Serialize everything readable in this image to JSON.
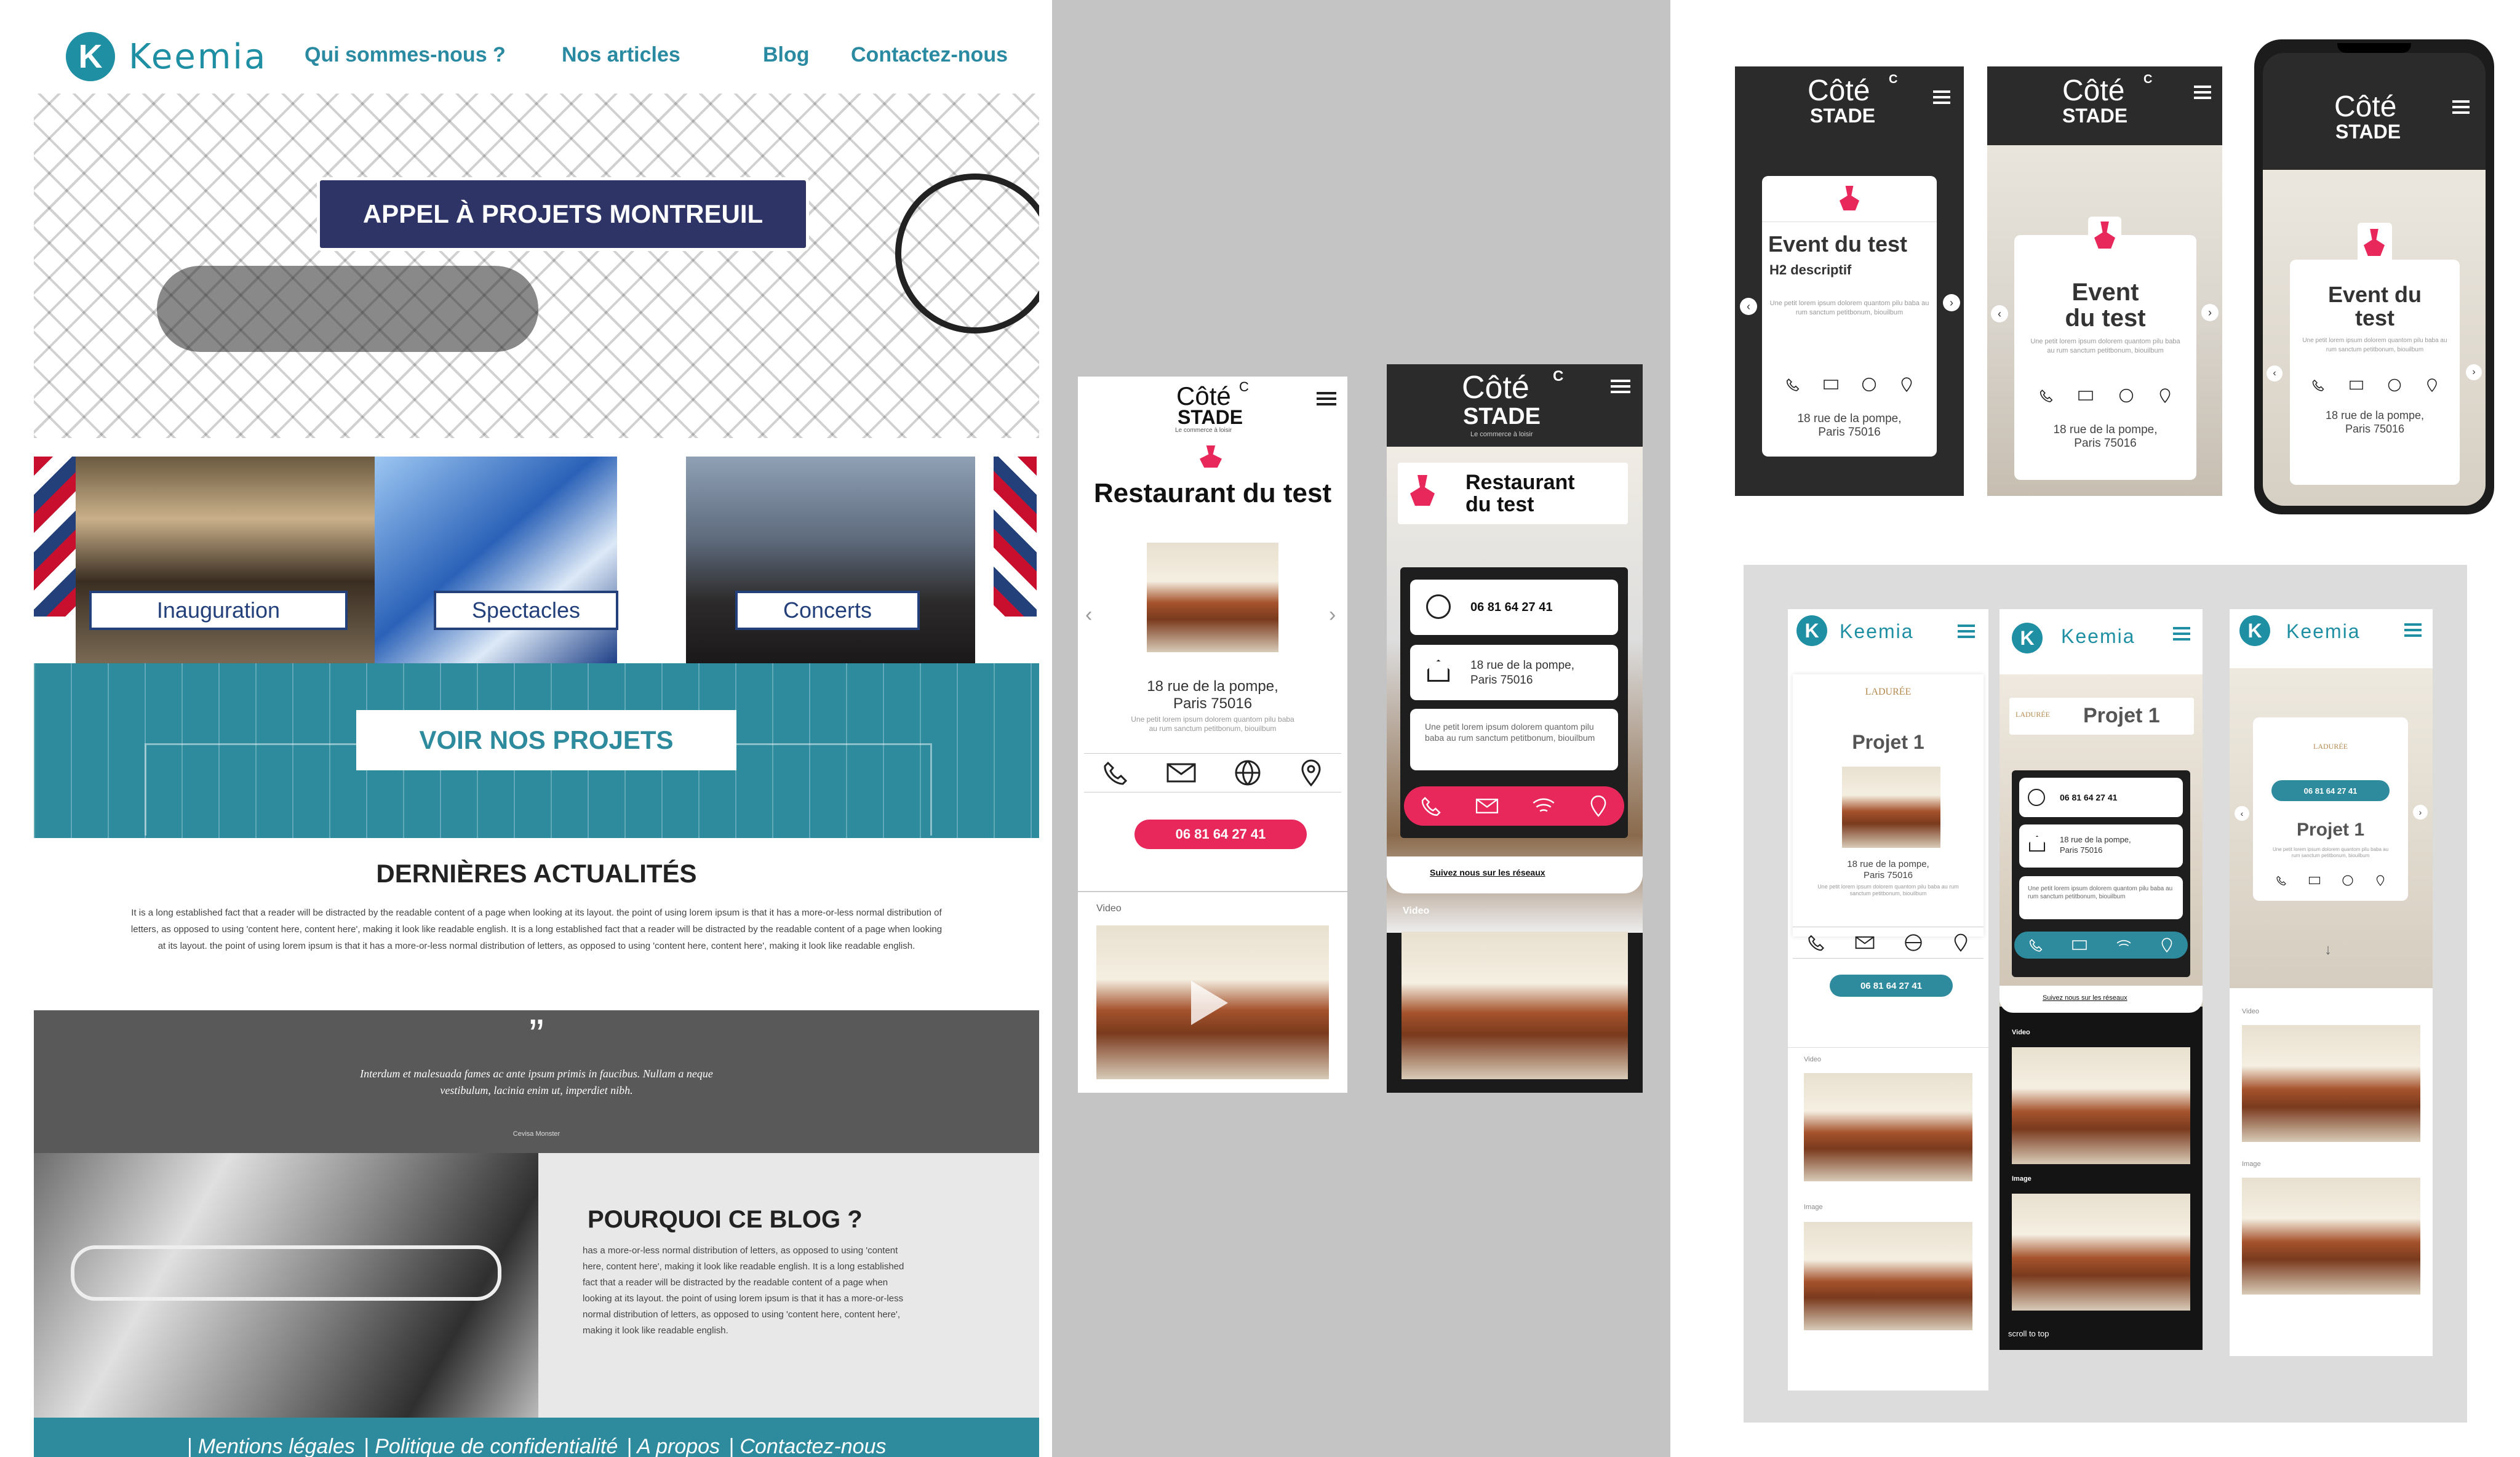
{
  "desktop": {
    "logo_letter": "K",
    "logo_word": "Keemia",
    "nav": [
      "Qui sommes-nous ?",
      "Nos articles",
      "Blog",
      "Contactez-nous"
    ],
    "hero_button": "APPEL À PROJETS MONTREUIL",
    "categories": [
      "Inauguration",
      "Spectacles",
      "Concerts"
    ],
    "projects_button": "VOIR NOS PROJETS",
    "news_title": "DERNIÈRES ACTUALITÉS",
    "news_text": "It is a long established fact that a reader will be distracted by the readable content of a page when looking at its layout. the point of using lorem ipsum is that it has a more-or-less normal distribution of letters, as opposed to using 'content here, content here', making it look like readable english. It is a long established fact that a reader will be distracted by the readable content of a page when looking at its layout. the point of using lorem ipsum is that it has a more-or-less normal distribution of letters, as opposed to using 'content here, content here', making it look like readable english.",
    "quote_mark": "”",
    "quote": "Interdum et malesuada fames ac ante ipsum primis in faucibus. Nullam a neque vestibulum, lacinia enim ut, imperdiet nibh.",
    "quote_author": "Cevisa Monster",
    "why_title": "POURQUOI CE BLOG ?",
    "why_text": "has a more-or-less normal distribution of letters, as opposed to using 'content here, content here', making it look like readable english. It is a long established fact that a reader will be distracted by the readable content of a page when looking at its layout. the point of using lorem ipsum is that it has a more-or-less normal distribution of letters, as opposed to using 'content here, content here', making it look like readable english.",
    "footer": [
      "| Mentions légales",
      "| Politique de confidentialité",
      "| A propos",
      "| Contactez-nous"
    ]
  },
  "cote": {
    "brand_top": "Côté",
    "brand_bottom": "STADE",
    "brand_mark": "C",
    "tagline": "Le commerce à loisir",
    "restaurant_title": "Restaurant du test",
    "address_1": "18 rue de la pompe,",
    "address_2": "Paris 75016",
    "lorem_short": "Une petit lorem ipsum dolorem quantom pilu baba au rum sanctum petitbonum, biouilbum",
    "phone": "06 81 64 27 41",
    "video_label": "Video",
    "networks": "Suivez nous sur les réseaux",
    "event_title": "Event du test",
    "event_h2": "H2 descriptif"
  },
  "keemia_mobile": {
    "logo_word": "Keemia",
    "project_title": "Projet 1",
    "brand_small": "LADURÉE",
    "video_label": "Video",
    "image_label": "Image",
    "scroll_top": "scroll to top"
  },
  "colors": {
    "teal": "#2e8b9e",
    "navy": "#2e3566",
    "pink": "#e8285a",
    "dark": "#2b2b2b",
    "grey_bg": "#c4c4c4"
  }
}
